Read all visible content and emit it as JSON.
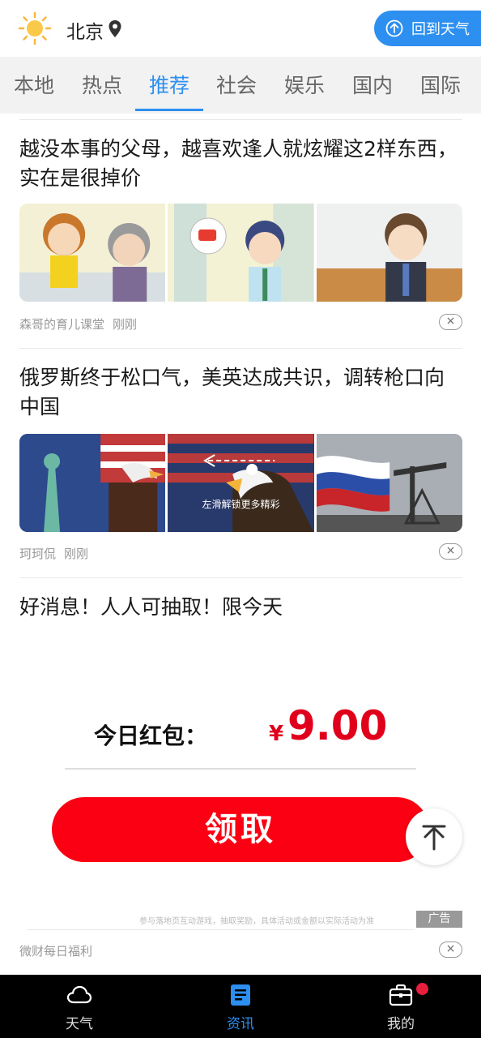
{
  "header": {
    "city": "北京",
    "back_button_label": "回到天气"
  },
  "tabs": [
    {
      "label": "本地"
    },
    {
      "label": "热点"
    },
    {
      "label": "推荐",
      "active": true
    },
    {
      "label": "社会"
    },
    {
      "label": "娱乐"
    },
    {
      "label": "国内"
    },
    {
      "label": "国际"
    }
  ],
  "articles": [
    {
      "title": "越没本事的父母，越喜欢逢人就炫耀这2样东西，实在是很掉价",
      "source": "森哥的育儿课堂",
      "time": "刚刚"
    },
    {
      "title": "俄罗斯终于松口气，美英达成共识，调转枪口向中国",
      "source": "珂珂侃",
      "time": "刚刚",
      "swipe_hint": "左滑解锁更多精彩"
    }
  ],
  "ad": {
    "title": "好消息！人人可抽取！限今天",
    "red_label": "今日红包：",
    "currency": "¥",
    "amount": "9.00",
    "claim_label": "领取",
    "disclaimer": "参与落地页互动游戏，抽取奖励，具体活动或金额以实际活动为准",
    "ad_tag": "广告",
    "source": "微财每日福利"
  },
  "close_symbol": "×",
  "bottom_nav": [
    {
      "label": "天气",
      "icon": "cloud-icon"
    },
    {
      "label": "资讯",
      "icon": "news-icon",
      "active": true
    },
    {
      "label": "我的",
      "icon": "briefcase-icon",
      "badge": true
    }
  ],
  "colors": {
    "accent": "#2d8ff0",
    "red": "#e0001b",
    "claim_button": "#fb0012"
  }
}
